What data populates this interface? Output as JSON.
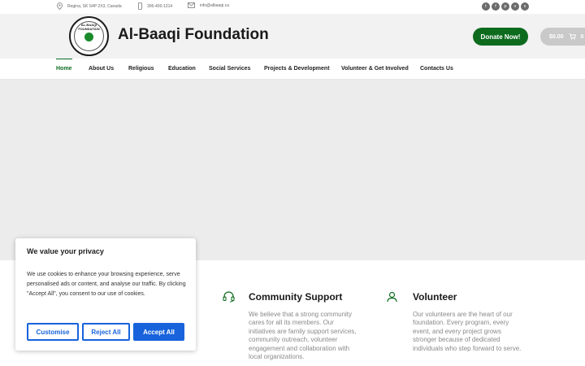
{
  "topbar": {
    "address": "Regina, SK S4P 2X3, Canada",
    "phone": "306-400-1314",
    "email": "info@albaaqi.ca",
    "social_icons": [
      "twitter-icon",
      "facebook-icon",
      "pinterest-icon",
      "vimeo-icon",
      "skype-icon"
    ]
  },
  "header": {
    "logo_text": "AL-BAAQI FOUNDATION",
    "brand": "Al-Baaqi Foundation",
    "donate_label": "Donate Now!",
    "cart_total": "$0.00",
    "cart_count": "0"
  },
  "nav": {
    "items": [
      "Home",
      "About Us",
      "Religious",
      "Education",
      "Social Services",
      "Projects & Development",
      "Volunteer & Get Involved",
      "Contacts Us"
    ],
    "active": "Home"
  },
  "features": [
    {
      "title": "Community Support",
      "text": "We believe that a strong community cares for all its members. Our initiatives are family support services, community outreach, volunteer engagement and collaboration with local organizations."
    },
    {
      "title": "Volunteer",
      "text": "Our volunteers are the heart of our foundation. Every program, every event, and every project grows stronger because of dedicated individuals who step forward to serve."
    }
  ],
  "cookie": {
    "title": "We value your privacy",
    "body": "We use cookies to enhance your browsing experience, serve personalised ads or content, and analyse our traffic. By clicking \"Accept All\", you consent to our use of cookies.",
    "customise": "Customise",
    "reject": "Reject All",
    "accept": "Accept All"
  },
  "colors": {
    "brand_green": "#0d6b1e",
    "cookie_blue": "#1863dc",
    "hero_bg": "#ececec"
  }
}
